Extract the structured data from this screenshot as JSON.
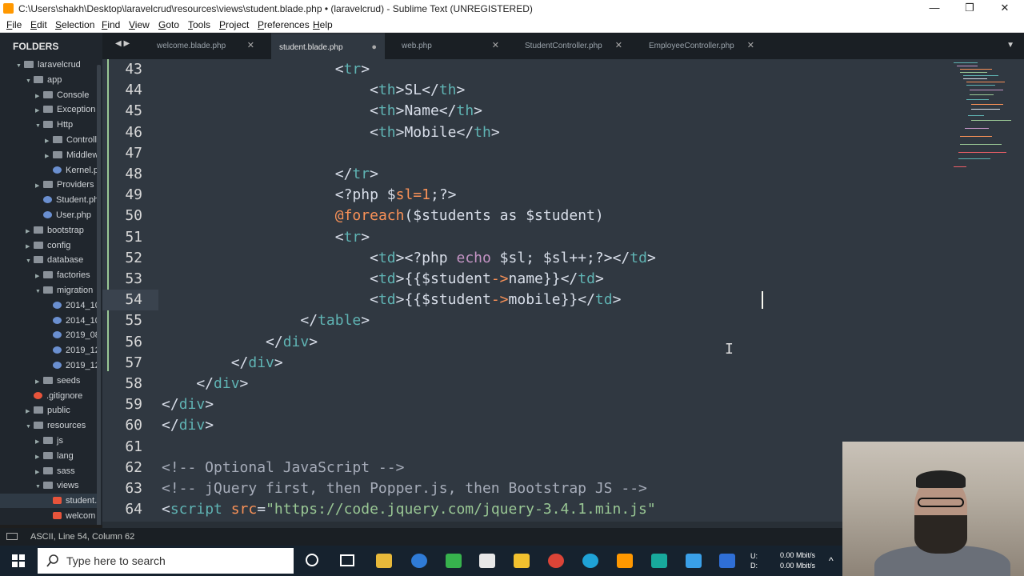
{
  "window": {
    "title": "C:\\Users\\shakh\\Desktop\\laravelcrud\\resources\\views\\student.blade.php • (laravelcrud) - Sublime Text (UNREGISTERED)",
    "minimize": "—",
    "restore": "❐",
    "close": "✕"
  },
  "menu": [
    "File",
    "Edit",
    "Selection",
    "Find",
    "View",
    "Goto",
    "Tools",
    "Project",
    "Preferences",
    "Help"
  ],
  "sidebar": {
    "heading": "FOLDERS",
    "items": [
      {
        "label": "laravelcrud",
        "type": "folder",
        "open": true
      },
      {
        "label": "app",
        "type": "folder",
        "open": true
      },
      {
        "label": "Console",
        "type": "folder",
        "open": false
      },
      {
        "label": "Exception",
        "type": "folder",
        "open": false
      },
      {
        "label": "Http",
        "type": "folder",
        "open": true
      },
      {
        "label": "Controll",
        "type": "folder",
        "open": false
      },
      {
        "label": "Middlew",
        "type": "folder",
        "open": false
      },
      {
        "label": "Kernel.p",
        "type": "php"
      },
      {
        "label": "Providers",
        "type": "folder",
        "open": false
      },
      {
        "label": "Student.ph",
        "type": "php"
      },
      {
        "label": "User.php",
        "type": "php"
      },
      {
        "label": "bootstrap",
        "type": "folder",
        "open": false
      },
      {
        "label": "config",
        "type": "folder",
        "open": false
      },
      {
        "label": "database",
        "type": "folder",
        "open": true
      },
      {
        "label": "factories",
        "type": "folder",
        "open": false
      },
      {
        "label": "migration",
        "type": "folder",
        "open": true
      },
      {
        "label": "2014_10",
        "type": "php"
      },
      {
        "label": "2014_10",
        "type": "php"
      },
      {
        "label": "2019_08",
        "type": "php"
      },
      {
        "label": "2019_12",
        "type": "php"
      },
      {
        "label": "2019_12",
        "type": "php"
      },
      {
        "label": "seeds",
        "type": "folder",
        "open": false
      },
      {
        "label": ".gitignore",
        "type": "git"
      },
      {
        "label": "public",
        "type": "folder",
        "open": false
      },
      {
        "label": "resources",
        "type": "folder",
        "open": true
      },
      {
        "label": "js",
        "type": "folder",
        "open": false
      },
      {
        "label": "lang",
        "type": "folder",
        "open": false
      },
      {
        "label": "sass",
        "type": "folder",
        "open": false
      },
      {
        "label": "views",
        "type": "folder",
        "open": true
      },
      {
        "label": "student.",
        "type": "blade",
        "selected": true
      },
      {
        "label": "welcom",
        "type": "blade"
      }
    ]
  },
  "tabs": [
    {
      "label": "welcome.blade.php",
      "active": false,
      "marker": "✕"
    },
    {
      "label": "student.blade.php",
      "active": true,
      "marker": "●"
    },
    {
      "label": "web.php",
      "active": false,
      "marker": "✕"
    },
    {
      "label": "StudentController.php",
      "active": false,
      "marker": "✕"
    },
    {
      "label": "EmployeeController.php",
      "active": false,
      "marker": "✕"
    }
  ],
  "editor": {
    "lines": [
      {
        "n": "43",
        "segs": [
          [
            "p",
            "                    "
          ],
          [
            "p",
            "<"
          ],
          [
            "t",
            "tr"
          ],
          [
            "p",
            ">"
          ]
        ]
      },
      {
        "n": "44",
        "segs": [
          [
            "p",
            "                        <"
          ],
          [
            "t",
            "th"
          ],
          [
            "p",
            ">SL</"
          ],
          [
            "t",
            "th"
          ],
          [
            "p",
            ">"
          ]
        ]
      },
      {
        "n": "45",
        "segs": [
          [
            "p",
            "                        <"
          ],
          [
            "t",
            "th"
          ],
          [
            "p",
            ">Name</"
          ],
          [
            "t",
            "th"
          ],
          [
            "p",
            ">"
          ]
        ]
      },
      {
        "n": "46",
        "segs": [
          [
            "p",
            "                        <"
          ],
          [
            "t",
            "th"
          ],
          [
            "p",
            ">Mobile</"
          ],
          [
            "t",
            "th"
          ],
          [
            "p",
            ">"
          ]
        ]
      },
      {
        "n": "47",
        "segs": []
      },
      {
        "n": "48",
        "segs": [
          [
            "p",
            "                    </"
          ],
          [
            "t",
            "tr"
          ],
          [
            "p",
            ">"
          ]
        ]
      },
      {
        "n": "49",
        "segs": [
          [
            "p",
            "                    <?php "
          ],
          [
            "v",
            "$"
          ],
          [
            "o",
            "sl"
          ],
          [
            "o",
            "="
          ],
          [
            "o",
            "1"
          ],
          [
            "p",
            ";?>"
          ]
        ]
      },
      {
        "n": "50",
        "segs": [
          [
            "p",
            "                    "
          ],
          [
            "o",
            "@"
          ],
          [
            "o",
            "foreach"
          ],
          [
            "p",
            "("
          ],
          [
            "v",
            "$students "
          ],
          [
            "v",
            "as "
          ],
          [
            "v",
            "$student"
          ],
          [
            "p",
            ")"
          ]
        ]
      },
      {
        "n": "51",
        "segs": [
          [
            "p",
            "                    <"
          ],
          [
            "t",
            "tr"
          ],
          [
            "p",
            ">"
          ]
        ]
      },
      {
        "n": "52",
        "segs": [
          [
            "p",
            "                        <"
          ],
          [
            "t",
            "td"
          ],
          [
            "p",
            "><?php "
          ],
          [
            "k",
            "echo "
          ],
          [
            "v",
            "$sl; $sl++;"
          ],
          [
            "p",
            "?></"
          ],
          [
            "t",
            "td"
          ],
          [
            "p",
            ">"
          ]
        ]
      },
      {
        "n": "53",
        "segs": [
          [
            "p",
            "                        <"
          ],
          [
            "t",
            "td"
          ],
          [
            "p",
            ">{{"
          ],
          [
            "v",
            "$student"
          ],
          [
            "o",
            "->"
          ],
          [
            "v",
            "name"
          ],
          [
            "p",
            "}}</"
          ],
          [
            "t",
            "td"
          ],
          [
            "p",
            ">"
          ]
        ]
      },
      {
        "n": "54",
        "segs": [
          [
            "p",
            "                        <"
          ],
          [
            "t",
            "td"
          ],
          [
            "p",
            ">{{"
          ],
          [
            "v",
            "$student"
          ],
          [
            "o",
            "->"
          ],
          [
            "v",
            "mobile"
          ],
          [
            "p",
            "}}</"
          ],
          [
            "t",
            "td"
          ],
          [
            "p",
            ">"
          ]
        ]
      },
      {
        "n": "55",
        "segs": [
          [
            "p",
            "                </"
          ],
          [
            "t",
            "table"
          ],
          [
            "p",
            ">"
          ]
        ]
      },
      {
        "n": "56",
        "segs": [
          [
            "p",
            "            </"
          ],
          [
            "t",
            "div"
          ],
          [
            "p",
            ">"
          ]
        ]
      },
      {
        "n": "57",
        "segs": [
          [
            "p",
            "        </"
          ],
          [
            "t",
            "div"
          ],
          [
            "p",
            ">"
          ]
        ]
      },
      {
        "n": "58",
        "segs": [
          [
            "p",
            "    </"
          ],
          [
            "t",
            "div"
          ],
          [
            "p",
            ">"
          ]
        ]
      },
      {
        "n": "59",
        "segs": [
          [
            "p",
            "</"
          ],
          [
            "t",
            "div"
          ],
          [
            "p",
            ">"
          ]
        ]
      },
      {
        "n": "60",
        "segs": [
          [
            "p",
            "</"
          ],
          [
            "t",
            "div"
          ],
          [
            "p",
            ">"
          ]
        ]
      },
      {
        "n": "61",
        "segs": []
      },
      {
        "n": "62",
        "segs": [
          [
            "c",
            "<!-- Optional JavaScript -->"
          ]
        ]
      },
      {
        "n": "63",
        "segs": [
          [
            "c",
            "<!-- jQuery first, then Popper.js, then Bootstrap JS -->"
          ]
        ]
      },
      {
        "n": "64",
        "segs": [
          [
            "p",
            "<"
          ],
          [
            "t",
            "script "
          ],
          [
            "o",
            "src"
          ],
          [
            "p",
            "="
          ],
          [
            "s",
            "\"https://code.jquery.com/jquery-3.4.1.min.js\""
          ]
        ]
      }
    ]
  },
  "status": {
    "left": "ASCII, Line 54, Column 62"
  },
  "taskbar": {
    "search_placeholder": "Type here to search",
    "net_up": "0.00 Mbit/s",
    "net_down": "0.00 Mbit/s",
    "u_label": "U:",
    "d_label": "D:"
  }
}
